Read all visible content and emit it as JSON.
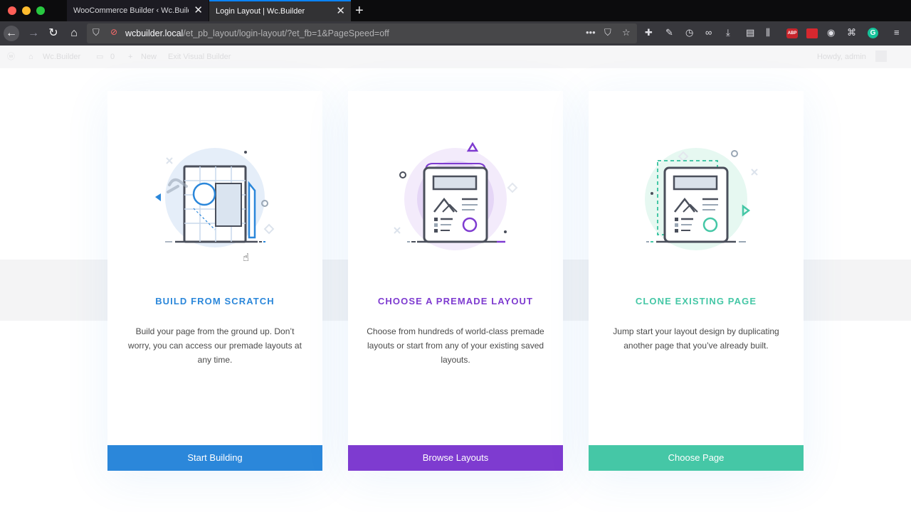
{
  "browser": {
    "tabs": [
      {
        "title": "WooCommerce Builder ‹ Wc.Builder",
        "active": false
      },
      {
        "title": "Login Layout | Wc.Builder",
        "active": true
      }
    ],
    "url_host": "wcbuilder.local",
    "url_path": "/et_pb_layout/login-layout/?et_fb=1&PageSpeed=off",
    "abp_label": "ABP",
    "grammarly_label": "G"
  },
  "admin_bar": {
    "site_name": "Wc.Builder",
    "comments_count": "0",
    "new_label": "New",
    "exit_label": "Exit Visual Builder",
    "howdy": "Howdy, admin"
  },
  "cards": [
    {
      "title": "BUILD FROM SCRATCH",
      "description": "Build your page from the ground up. Don’t worry, you can access our premade layouts at any time.",
      "button": "Start Building",
      "color": "#2b87da"
    },
    {
      "title": "CHOOSE A PREMADE LAYOUT",
      "description": "Choose from hundreds of world-class premade layouts or start from any of your existing saved layouts.",
      "button": "Browse Layouts",
      "color": "#7e3bd0"
    },
    {
      "title": "CLONE EXISTING PAGE",
      "description": "Jump start your layout design by duplicating another page that you’ve already built.",
      "button": "Choose Page",
      "color": "#45c7a6"
    }
  ],
  "icons": {
    "card1": "blueprint-pencil-icon",
    "card2": "layout-document-icon",
    "card3": "clone-document-icon"
  }
}
